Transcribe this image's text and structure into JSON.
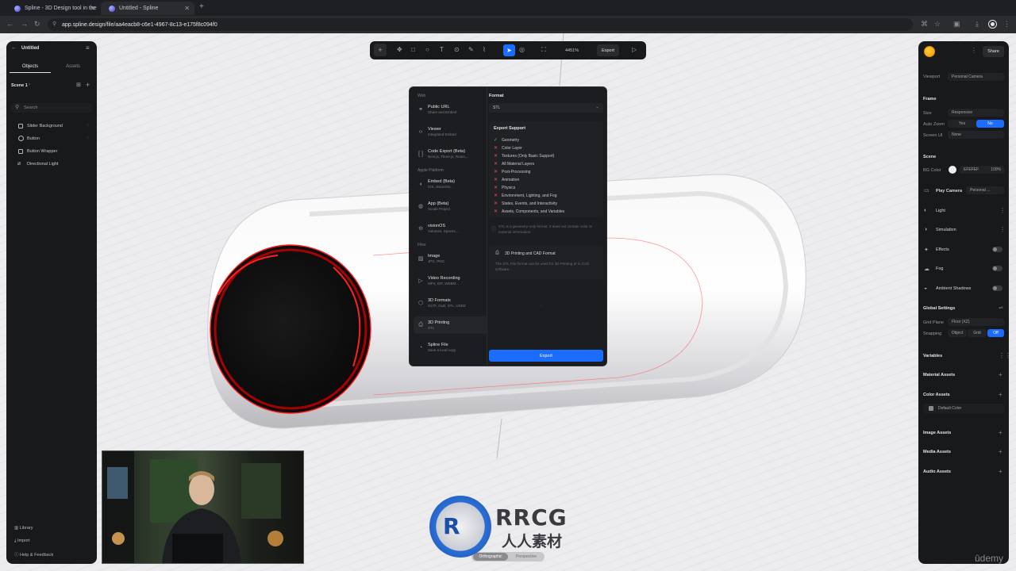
{
  "browser": {
    "tabs": [
      {
        "title": "Spline - 3D Design tool in the"
      },
      {
        "title": "Untitled - Spline"
      }
    ],
    "url": "app.spline.design/file/aa4eacb8-c6e1-4967-8c13-e175f8c094f0"
  },
  "left_panel": {
    "file_title": "Untitled",
    "tabs": [
      "Objects",
      "Assets"
    ],
    "scene_label": "Scene 1",
    "search_placeholder": "Search",
    "objects": [
      {
        "label": "Slider Background",
        "icon": "square-icon"
      },
      {
        "label": "Button",
        "icon": "circle-icon"
      },
      {
        "label": "Button Wrapper",
        "icon": "square-icon"
      },
      {
        "label": "Directional Light",
        "icon": "light-icon"
      }
    ],
    "footer": [
      "Library",
      "Import",
      "Help & Feedback"
    ]
  },
  "toolbar": {
    "zoom": "4451%",
    "export_label": "Export"
  },
  "export_modal": {
    "sections": [
      {
        "title": "Web",
        "items": [
          {
            "title": "Public URL",
            "sub": "Share and Embed",
            "icon": "link-icon"
          },
          {
            "title": "Viewer",
            "sub": "Integrated Embed",
            "icon": "code-icon"
          },
          {
            "title": "Code Export (Beta)",
            "sub": "Next.js, Three.js, React,...",
            "icon": "brackets-icon"
          }
        ]
      },
      {
        "title": "Apple Platform",
        "items": [
          {
            "title": "Embed (Beta)",
            "sub": "iOS, visionOS...",
            "icon": "apple-icon"
          },
          {
            "title": "App (Beta)",
            "sub": "Xcode Project",
            "icon": "app-icon"
          },
          {
            "title": "visionOS",
            "sub": "Volumes, Spaces,...",
            "icon": "vision-icon"
          }
        ]
      },
      {
        "title": "Files",
        "items": [
          {
            "title": "Image",
            "sub": "JPG, PNG",
            "icon": "image-icon"
          },
          {
            "title": "Video Recording",
            "sub": "MP4, GIF, WEBM...",
            "icon": "play-icon"
          },
          {
            "title": "3D Formats",
            "sub": "GLTF, GLB, STL, USDZ",
            "icon": "cube-icon"
          },
          {
            "title": "3D Printing",
            "sub": "STL",
            "icon": "printer-icon"
          },
          {
            "title": "Spline File",
            "sub": "Save a local copy",
            "icon": "file-icon"
          }
        ]
      }
    ],
    "format_label": "Format",
    "format_value": "STL",
    "support_title": "Export Support",
    "support": [
      {
        "label": "Geometry",
        "ok": true
      },
      {
        "label": "Color Layer",
        "ok": false
      },
      {
        "label": "Textures (Only Basic Support)",
        "ok": false
      },
      {
        "label": "All Material Layers",
        "ok": false
      },
      {
        "label": "Post-Processing",
        "ok": false
      },
      {
        "label": "Animation",
        "ok": false
      },
      {
        "label": "Physics",
        "ok": false
      },
      {
        "label": "Environment, Lighting, and Fog",
        "ok": false
      },
      {
        "label": "States, Events, and Interactivity",
        "ok": false
      },
      {
        "label": "Assets, Components, and Variables",
        "ok": false
      }
    ],
    "note": "STL is a geometry-only format. It does not contain color or material information.",
    "info_title": "3D Printing and CAD Format",
    "info_text": "The STL File format can be used for 3D Printing or in CAD software.",
    "export_button": "Export"
  },
  "right_panel": {
    "share_label": "Share",
    "viewport_label": "Viewport",
    "viewport_value": "Personal Camera",
    "frame_title": "Frame",
    "size_label": "Size",
    "size_value": "Responsive",
    "autozoom_label": "Auto Zoom",
    "autozoom_yes": "Yes",
    "autozoom_no": "No",
    "screenui_label": "Screen UI",
    "screenui_value": "None",
    "scene_title": "Scene",
    "bgcolor_label": "BG Color",
    "bgcolor_hex": "EFEFEF",
    "bgcolor_opacity": "100%",
    "play_camera_label": "Play Camera",
    "play_camera_value": "Personal ...",
    "scene_rows": [
      "Light",
      "Simulation",
      "Effects",
      "Fog",
      "Ambient Shadows"
    ],
    "global_title": "Global Settings",
    "grid_plane_label": "Grid Plane",
    "grid_plane_value": "Floor (XZ)",
    "snapping_label": "Snapping",
    "snapping_options": [
      "Object",
      "Grid",
      "Off"
    ],
    "sections": [
      "Variables",
      "Material Assets",
      "Color Assets",
      "Image Assets",
      "Media Assets",
      "Audio Assets"
    ],
    "default_color": "Default Color"
  },
  "bottom_switch": [
    "Orthographic",
    "Perspective"
  ],
  "watermark": {
    "brand": "RRCG",
    "sub": "人人素材",
    "udemy": "ûdemy"
  },
  "colors": {
    "accent": "#1a6dff",
    "selection": "#ff2a2a"
  }
}
